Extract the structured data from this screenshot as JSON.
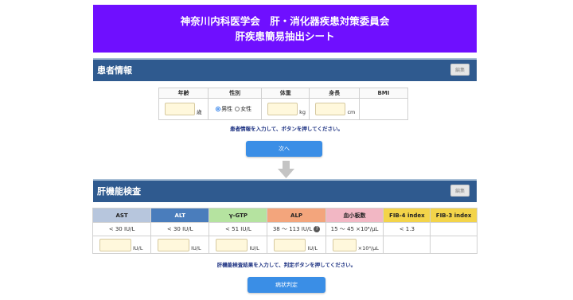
{
  "header": {
    "line1": "神奈川内科医学会　肝・消化器疾患対策委員会",
    "line2": "肝疾患簡易抽出シート"
  },
  "patient_section": {
    "title": "患者情報",
    "edit_label": "編集",
    "columns": [
      "年齢",
      "性別",
      "体重",
      "身長",
      "BMI"
    ],
    "age_unit": "歳",
    "gender_options": [
      "男性",
      "女性"
    ],
    "gender_selected": "男性",
    "weight_unit": "kg",
    "height_unit": "cm",
    "note": "患者情報を入力して、ボタンを押してください。",
    "next_button": "次へ"
  },
  "liver_section": {
    "title": "肝機能検査",
    "edit_label": "編集",
    "columns": [
      {
        "label": "AST",
        "color": "#b7c6dd"
      },
      {
        "label": "ALT",
        "color": "#4a7dbc"
      },
      {
        "label": "γ-GTP",
        "color": "#b5e3a0"
      },
      {
        "label": "ALP",
        "color": "#f3a57c"
      },
      {
        "label": "血小板数",
        "color": "#f2b7c4"
      },
      {
        "label": "FIB-4 index",
        "color": "#f3d44a"
      },
      {
        "label": "FIB-3 index",
        "color": "#f3d44a"
      }
    ],
    "reference": [
      "< 30 IU/L",
      "< 30 IU/L",
      "< 51 IU/L",
      "38 ～ 113 IU/L",
      "15 ～ 45 ×10⁴/μL",
      "< 1.3",
      ""
    ],
    "units": [
      "IU/L",
      "IU/L",
      "IU/L",
      "IU/L",
      "×10⁴/μL"
    ],
    "note": "肝機能検査結果を入力して、判定ボタンを押してください。",
    "judge_button": "病状判定"
  }
}
